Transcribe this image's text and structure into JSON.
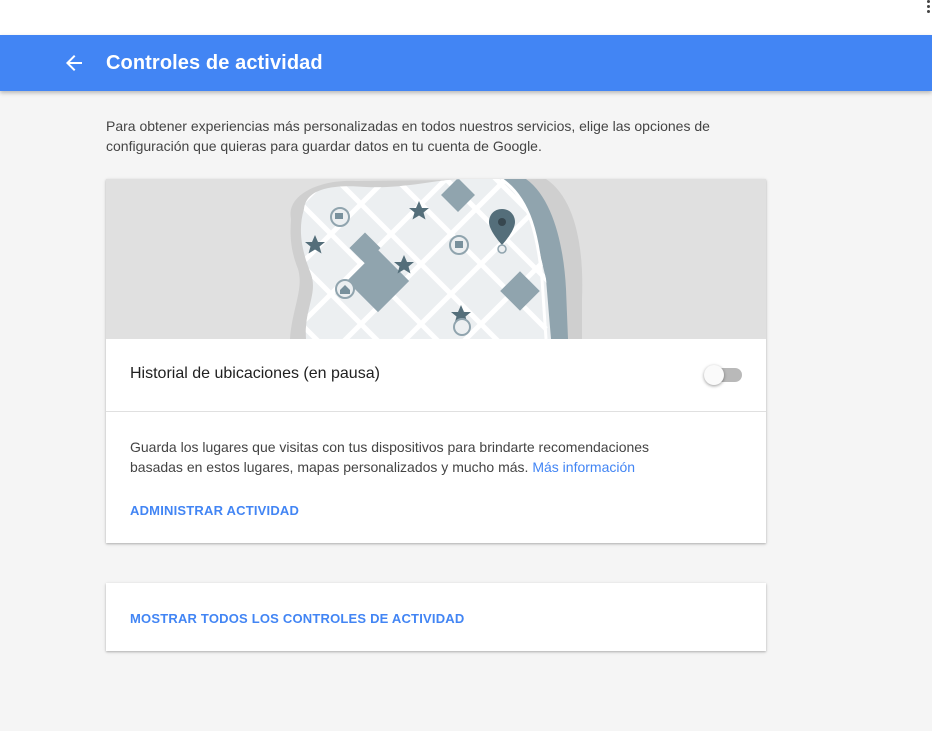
{
  "header": {
    "title": "Controles de actividad",
    "back_icon": "arrow-back-icon",
    "background_color": "#4285f4"
  },
  "intro": {
    "text": "Para obtener experiencias más personalizadas en todos nuestros servicios, elige las opciones de configuración que quieras para guardar datos en tu cuenta de Google."
  },
  "location_card": {
    "illustration": "city-map-illustration",
    "title": "Historial de ubicaciones (en pausa)",
    "toggle_on": false,
    "description": "Guarda los lugares que visitas con tus dispositivos para brindarte recomendaciones basadas en estos lugares, mapas personalizados y mucho más.",
    "learn_more": "Más información",
    "manage_button": "ADMINISTRAR ACTIVIDAD"
  },
  "all_controls": {
    "button": "MOSTRAR TODOS LOS CONTROLES DE ACTIVIDAD"
  },
  "colors": {
    "accent": "#4285f4",
    "page_bg": "#f5f5f5",
    "map_bg": "#e0e0e0",
    "map_dark": "#90a4ae",
    "map_marker": "#546e7a"
  }
}
